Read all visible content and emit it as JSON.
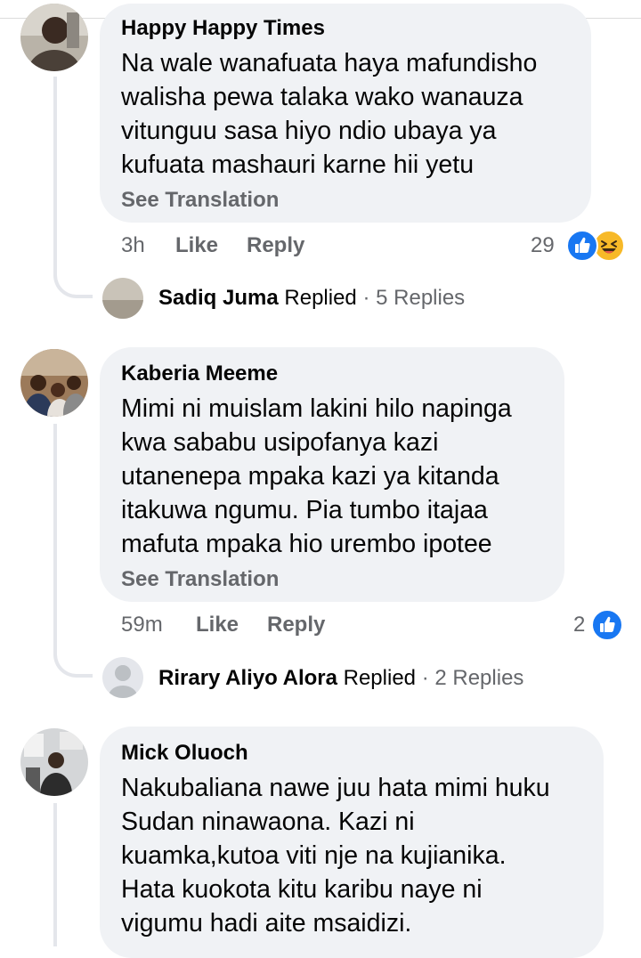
{
  "comments": [
    {
      "author": "Happy Happy Times",
      "lines": [
        "Na wale wanafuata haya mafundisho",
        "walisha pewa talaka wako wanauza",
        "vitunguu sasa hiyo ndio ubaya ya",
        "kufuata mashauri karne hii yetu"
      ],
      "see_translation": "See Translation",
      "time": "3h",
      "like_label": "Like",
      "reply_label": "Reply",
      "reaction_count": "29",
      "reactions": [
        "like-icon",
        "haha-icon"
      ],
      "replies": {
        "name": "Sadiq Juma",
        "verb": "Replied",
        "separator": "·",
        "count": "5 Replies"
      }
    },
    {
      "author": "Kaberia Meeme",
      "lines": [
        "Mimi ni muislam lakini hilo napinga",
        "kwa sababu usipofanya kazi",
        "utanenepa mpaka kazi ya kitanda",
        "itakuwa ngumu. Pia tumbo itajaa",
        "mafuta mpaka hio urembo ipotee"
      ],
      "see_translation": "See Translation",
      "time": "59m",
      "like_label": "Like",
      "reply_label": "Reply",
      "reaction_count": "2",
      "reactions": [
        "like-icon"
      ],
      "replies": {
        "name": "Rirary Aliyo Alora",
        "verb": "Replied",
        "separator": "·",
        "count": "2 Replies"
      }
    },
    {
      "author": "Mick Oluoch",
      "lines": [
        "Nakubaliana nawe juu hata mimi huku",
        "Sudan ninawaona. Kazi ni",
        "kuamka,kutoa viti nje na kujianika.",
        "Hata kuokota kitu karibu naye ni",
        "vigumu hadi aite msaidizi."
      ]
    }
  ],
  "colors": {
    "bubble": "#f0f2f5",
    "secondary_text": "#65676b",
    "like_blue": "#1877f2",
    "haha_yellow": "#f7b928",
    "thread_line": "#e4e6eb"
  }
}
